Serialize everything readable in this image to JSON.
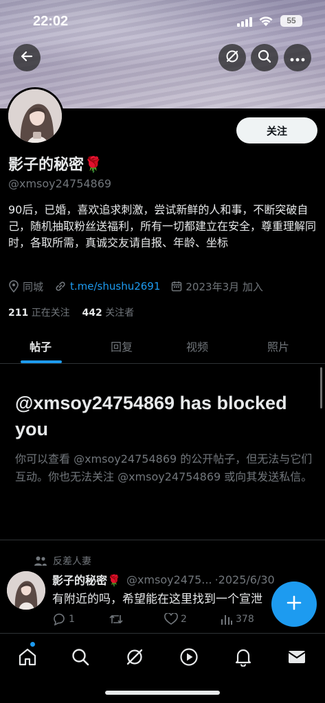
{
  "status_bar": {
    "time": "22:02",
    "battery": "55"
  },
  "header": {
    "back_icon": "back-arrow-icon",
    "grok_icon": "slash-circle-icon",
    "search_icon": "search-icon",
    "more_icon": "more-icon"
  },
  "profile": {
    "follow_label": "关注",
    "name": "影子的秘密",
    "name_emoji": "🌹",
    "handle": "@xmsoy24754869",
    "bio": "90后，已婚，喜欢追求刺激，尝试新鲜的人和事，不断突破自己，随机抽取粉丝送福利，所有一切都建立在安全，尊重理解同时，各取所需，真诚交友请自报、年龄、坐标",
    "location": "同城",
    "link": "t.me/shushu2691",
    "joined": "2023年3月 加入",
    "following_count": "211",
    "following_label": "正在关注",
    "followers_count": "442",
    "followers_label": "关注者"
  },
  "tabs": [
    {
      "label": "帖子",
      "active": true
    },
    {
      "label": "回复",
      "active": false
    },
    {
      "label": "视频",
      "active": false
    },
    {
      "label": "照片",
      "active": false
    }
  ],
  "blocked": {
    "title": "@xmsoy24754869 has blocked you",
    "description": "你可以查看 @xmsoy24754869 的公开帖子，但无法与它们互动。你也无法关注 @xmsoy24754869 或向其发送私信。"
  },
  "post": {
    "context_label": "反差人妻",
    "author_name": "影子的秘密🌹",
    "author_handle": "@xmsoy2475...",
    "date": "·2025/6/30",
    "text": "有附近的吗，希望能在这里找到一个宣泄",
    "replies": "1",
    "retweets": "",
    "likes": "2",
    "views": "378"
  },
  "colors": {
    "accent": "#1d9bf0",
    "background": "#000000",
    "text_primary": "#e7e9ea",
    "text_secondary": "#71767b"
  },
  "nav": [
    "home-icon",
    "search-icon",
    "grok-icon",
    "play-icon",
    "bell-icon",
    "mail-icon"
  ]
}
